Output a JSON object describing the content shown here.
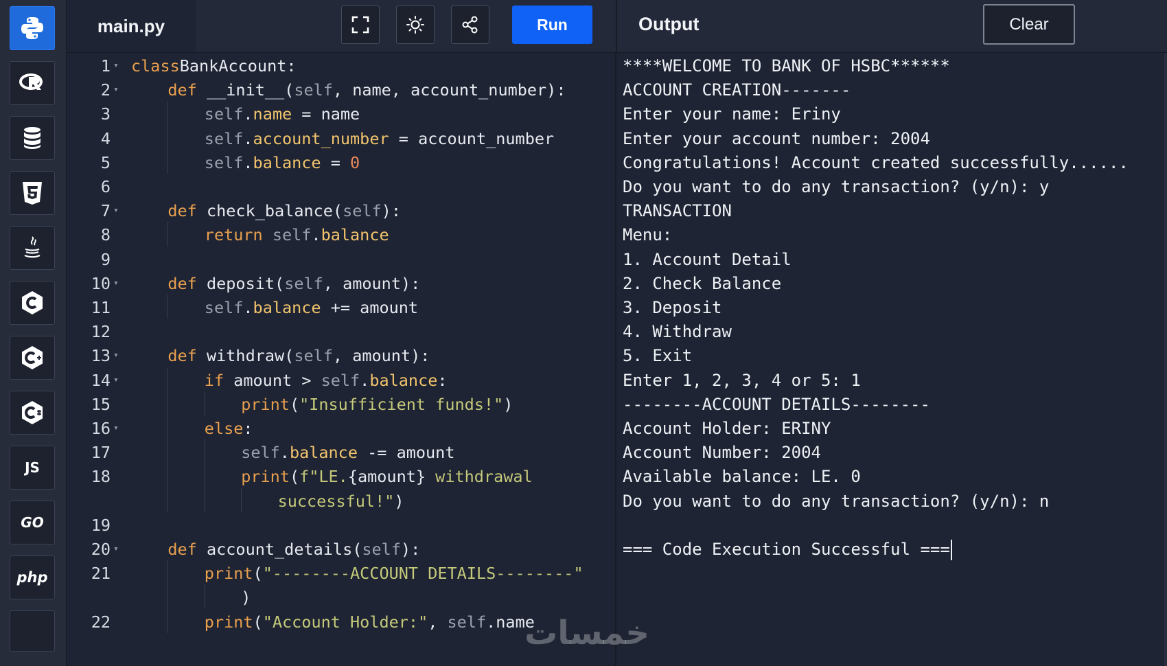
{
  "header": {
    "file_name": "main.py",
    "run_label": "Run",
    "output_title": "Output",
    "clear_label": "Clear",
    "tools": [
      "fullscreen-icon",
      "theme-toggle-icon",
      "share-icon"
    ]
  },
  "sidebar": {
    "items": [
      {
        "name": "python",
        "icon": "python-icon",
        "active": true
      },
      {
        "name": "r",
        "icon": "r-icon"
      },
      {
        "name": "sql",
        "icon": "database-icon"
      },
      {
        "name": "html",
        "icon": "html5-icon"
      },
      {
        "name": "java",
        "icon": "java-icon"
      },
      {
        "name": "c",
        "icon": "c-icon"
      },
      {
        "name": "cpp",
        "icon": "cpp-icon"
      },
      {
        "name": "csharp",
        "icon": "csharp-icon"
      },
      {
        "name": "javascript",
        "label": "JS"
      },
      {
        "name": "go",
        "label": "GO"
      },
      {
        "name": "php",
        "label": "php"
      }
    ]
  },
  "editor": {
    "lines": [
      {
        "n": "1",
        "fold": true,
        "indent": 0,
        "tokens": [
          [
            "k",
            "class"
          ],
          [
            "",
            "BankAccount:"
          ]
        ]
      },
      {
        "n": "2",
        "fold": true,
        "indent": 1,
        "tokens": [
          [
            "k",
            "def"
          ],
          [
            "",
            " __init__("
          ],
          [
            "s",
            "self"
          ],
          [
            "",
            ", name, account_number):"
          ]
        ]
      },
      {
        "n": "3",
        "indent": 2,
        "tokens": [
          [
            "s",
            "self"
          ],
          [
            "",
            "."
          ],
          [
            "a",
            "name"
          ],
          [
            "",
            " = name"
          ]
        ]
      },
      {
        "n": "4",
        "indent": 2,
        "tokens": [
          [
            "s",
            "self"
          ],
          [
            "",
            "."
          ],
          [
            "a",
            "account_number"
          ],
          [
            "",
            " = account_number"
          ]
        ]
      },
      {
        "n": "5",
        "indent": 2,
        "tokens": [
          [
            "s",
            "self"
          ],
          [
            "",
            "."
          ],
          [
            "a",
            "balance"
          ],
          [
            "",
            " = "
          ],
          [
            "n",
            "0"
          ]
        ]
      },
      {
        "n": "6",
        "indent": 0,
        "tokens": []
      },
      {
        "n": "7",
        "fold": true,
        "indent": 1,
        "tokens": [
          [
            "k",
            "def"
          ],
          [
            "",
            " check_balance("
          ],
          [
            "s",
            "self"
          ],
          [
            "",
            "):"
          ]
        ]
      },
      {
        "n": "8",
        "indent": 2,
        "tokens": [
          [
            "k",
            "return"
          ],
          [
            " ",
            ""
          ],
          [
            "s",
            " self"
          ],
          [
            "",
            "."
          ],
          [
            "a",
            "balance"
          ]
        ]
      },
      {
        "n": "9",
        "indent": 0,
        "tokens": []
      },
      {
        "n": "10",
        "fold": true,
        "indent": 1,
        "tokens": [
          [
            "k",
            "def"
          ],
          [
            "",
            " deposit("
          ],
          [
            "s",
            "self"
          ],
          [
            "",
            ", amount):"
          ]
        ]
      },
      {
        "n": "11",
        "indent": 2,
        "tokens": [
          [
            "s",
            "self"
          ],
          [
            "",
            "."
          ],
          [
            "a",
            "balance"
          ],
          [
            "",
            " += amount"
          ]
        ]
      },
      {
        "n": "12",
        "indent": 0,
        "tokens": []
      },
      {
        "n": "13",
        "fold": true,
        "indent": 1,
        "tokens": [
          [
            "k",
            "def"
          ],
          [
            "",
            " withdraw("
          ],
          [
            "s",
            "self"
          ],
          [
            "",
            ", amount):"
          ]
        ]
      },
      {
        "n": "14",
        "fold": true,
        "indent": 2,
        "tokens": [
          [
            "k",
            "if"
          ],
          [
            "",
            " amount > "
          ],
          [
            "s",
            "self"
          ],
          [
            "",
            "."
          ],
          [
            "a",
            "balance"
          ],
          [
            "",
            ":"
          ]
        ]
      },
      {
        "n": "15",
        "indent": 3,
        "tokens": [
          [
            "k",
            "print"
          ],
          [
            "",
            "("
          ],
          [
            "str",
            "\"Insufficient funds!\""
          ],
          [
            "",
            ")"
          ]
        ]
      },
      {
        "n": "16",
        "fold": true,
        "indent": 2,
        "tokens": [
          [
            "k",
            "else"
          ],
          [
            "",
            ":"
          ]
        ]
      },
      {
        "n": "17",
        "indent": 3,
        "tokens": [
          [
            "s",
            "self"
          ],
          [
            "",
            "."
          ],
          [
            "a",
            "balance"
          ],
          [
            "",
            " -= amount"
          ]
        ]
      },
      {
        "n": "18",
        "indent": 3,
        "tokens": [
          [
            "k",
            "print"
          ],
          [
            "",
            "("
          ],
          [
            "str",
            "f\"LE."
          ],
          [
            "",
            "{amount}"
          ],
          [
            "str",
            " withdrawal"
          ]
        ]
      },
      {
        "n": "",
        "indent": 4,
        "tokens": [
          [
            "str",
            "successful!\""
          ],
          [
            "",
            ")"
          ]
        ]
      },
      {
        "n": "19",
        "indent": 0,
        "tokens": []
      },
      {
        "n": "20",
        "fold": true,
        "indent": 1,
        "tokens": [
          [
            "k",
            "def"
          ],
          [
            "",
            " account_details("
          ],
          [
            "s",
            "self"
          ],
          [
            "",
            "):"
          ]
        ]
      },
      {
        "n": "21",
        "indent": 2,
        "tokens": [
          [
            "k",
            "print"
          ],
          [
            "",
            "("
          ],
          [
            "str",
            "\"--------ACCOUNT DETAILS--------\""
          ]
        ]
      },
      {
        "n": "",
        "indent": 3,
        "tokens": [
          [
            "",
            ")"
          ]
        ]
      },
      {
        "n": "22",
        "indent": 2,
        "tokens": [
          [
            "k",
            "print"
          ],
          [
            "",
            "("
          ],
          [
            "str",
            "\"Account Holder:\""
          ],
          [
            "",
            ", "
          ],
          [
            "s",
            "self"
          ],
          [
            "",
            ".name"
          ]
        ]
      }
    ]
  },
  "output": {
    "lines": [
      "****WELCOME TO BANK OF HSBC******",
      "ACCOUNT CREATION-------",
      "Enter your name: Eriny",
      "Enter your account number: 2004",
      "Congratulations! Account created successfully......",
      "Do you want to do any transaction? (y/n): y",
      "TRANSACTION",
      "Menu:",
      "1. Account Detail",
      "2. Check Balance",
      "3. Deposit",
      "4. Withdraw",
      "5. Exit",
      "Enter 1, 2, 3, 4 or 5: 1",
      "--------ACCOUNT DETAILS--------",
      "Account Holder: ERINY",
      "Account Number: 2004",
      "Available balance: LE. 0",
      "Do you want to do any transaction? (y/n): n",
      "",
      "=== Code Execution Successful ==="
    ]
  },
  "watermark": "خمسات"
}
